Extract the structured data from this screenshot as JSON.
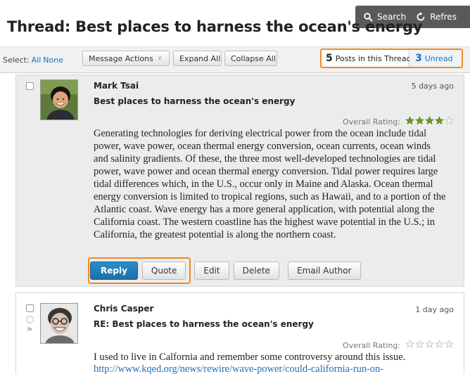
{
  "toolbar_top": {
    "search_label": "Search",
    "refresh_label": "Refres"
  },
  "thread": {
    "title": "Thread: Best places to harness the ocean's energy"
  },
  "toolbar": {
    "select_label": "Select:",
    "select_all": "All",
    "select_none": "None",
    "message_actions": "Message Actions",
    "expand_all": "Expand All",
    "collapse_all": "Collapse All",
    "posts_count": "5",
    "posts_label": "Posts in this Thread",
    "unread_count": "3",
    "unread_label": "Unread"
  },
  "posts": [
    {
      "author": "Mark Tsai",
      "date": "5 days ago",
      "subject": "Best places to harness the ocean's energy",
      "rating_label": "Overall Rating:",
      "rating": 4,
      "rating_max": 5,
      "body": "Generating technologies for deriving electrical power from the ocean include tidal power, wave power, ocean thermal energy conversion, ocean currents, ocean winds and salinity gradients. Of these, the three most well-developed technologies are tidal power, wave power and ocean thermal energy conversion. Tidal power requires large tidal differences which, in the U.S., occur only in Maine and Alaska. Ocean thermal energy conversion is limited to tropical regions, such as Hawaii, and to a portion of the Atlantic coast. Wave energy has a more general application, with potential along the California coast. The western coastline has the highest wave potential in the U.S.; in California, the greatest potential is along the northern coast.",
      "actions": {
        "reply": "Reply",
        "quote": "Quote",
        "edit": "Edit",
        "delete": "Delete",
        "email_author": "Email Author"
      }
    },
    {
      "author": "Chris Casper",
      "date": "1 day ago",
      "subject": "RE: Best places to harness the ocean's energy",
      "rating_label": "Overall Rating:",
      "rating": 0,
      "rating_max": 5,
      "body": "I used to live in Calfornia and remember some controversy around this issue.",
      "link": "http://www.kqed.org/news/rewire/wave-power/could-california-run-on-"
    }
  ],
  "colors": {
    "accent_orange": "#f08a24",
    "link_blue": "#1f6fb4",
    "reply_blue": "#1c6fa6",
    "star_green": "#6a9a1f"
  }
}
